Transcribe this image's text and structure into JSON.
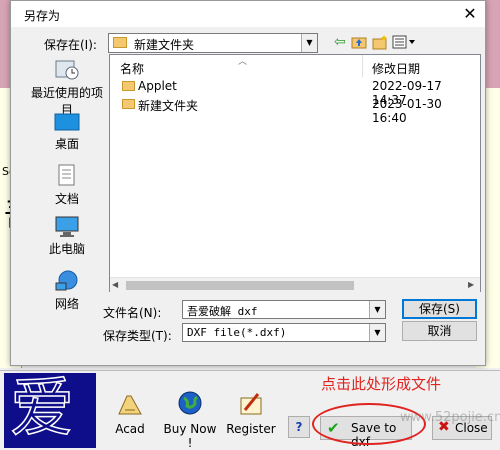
{
  "background_app": {
    "side_label": "Se",
    "big_char": "吾",
    "right_label": "t"
  },
  "dialog": {
    "title": "另存为",
    "close_glyph": "✕",
    "save_in_label": "保存在(I):",
    "save_in_value": "新建文件夹",
    "places": [
      {
        "label": "最近使用的项目",
        "icon": "recent-items-icon"
      },
      {
        "label": "桌面",
        "icon": "desktop-icon"
      },
      {
        "label": "文档",
        "icon": "documents-icon"
      },
      {
        "label": "此电脑",
        "icon": "this-pc-icon"
      },
      {
        "label": "网络",
        "icon": "network-icon"
      }
    ],
    "columns": {
      "name": "名称",
      "modified": "修改日期"
    },
    "files": [
      {
        "name": "Applet",
        "modified": "2022-09-17 14:37"
      },
      {
        "name": "新建文件夹",
        "modified": "2023-01-30 16:40"
      }
    ],
    "file_name_label": "文件名(N):",
    "file_name_value": "吾爱破解 dxf",
    "file_type_label": "保存类型(T):",
    "file_type_value": "DXF file(*.dxf)",
    "save_button": "保存(S)",
    "cancel_button": "取消"
  },
  "app_toolbar": {
    "logo_char": "爱",
    "tools": [
      {
        "label": "Acad",
        "icon": "acad-icon"
      },
      {
        "label": "Buy Now !",
        "icon": "globe-icon"
      },
      {
        "label": "Register",
        "icon": "register-icon"
      }
    ],
    "help_label": "?",
    "save_dxf_label": "Save to dxf",
    "close_label": "Close"
  },
  "annotation": "点击此处形成文件",
  "watermark": "www.52pojie.cn",
  "colors": {
    "annotation_red": "#e0231f",
    "logo_blue": "#0e0e8a",
    "focus_blue": "#0078d7",
    "folder_yellow": "#f4c870"
  }
}
